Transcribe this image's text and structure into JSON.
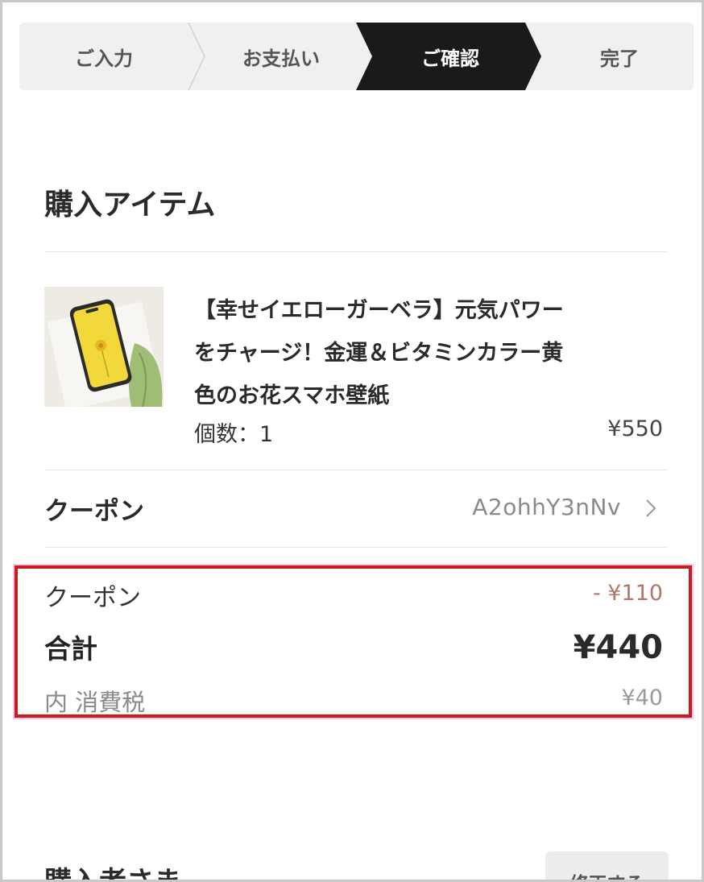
{
  "stepper": {
    "steps": [
      {
        "label": "ご入力"
      },
      {
        "label": "お支払い"
      },
      {
        "label": "ご確認"
      },
      {
        "label": "完了"
      }
    ],
    "active_step": "ご確認"
  },
  "items_section": {
    "title": "購入アイテム"
  },
  "product": {
    "title": "【幸せイエローガーベラ】元気パワーをチャージ！金運＆ビタミンカラー黄色のお花スマホ壁紙",
    "title_lines": [
      "【幸せイエローガーベラ】元気パワー",
      "をチャージ！金運＆ビタミンカラー黄",
      "色のお花スマホ壁紙"
    ],
    "quantity": "個数：1",
    "price": "¥550",
    "thumbnail": "yellow-flower-phone-wallpaper-image"
  },
  "coupon_row": {
    "label": "クーポン",
    "code": "A2ohhY3nNv",
    "icon": "chevron-right-icon"
  },
  "summary": {
    "discount_label": "クーポン",
    "discount_value": "- ¥110",
    "total_label": "合計",
    "total_value": "¥440",
    "tax_label": "内 消費税",
    "tax_value": "¥40"
  },
  "buyer_section": {
    "title": "購入者さま",
    "edit_label": "修正する"
  },
  "colors": {
    "active_step_bg": "#1a1a1a",
    "highlight_border": "#cc1b1b",
    "discount_text": "#b07868"
  }
}
